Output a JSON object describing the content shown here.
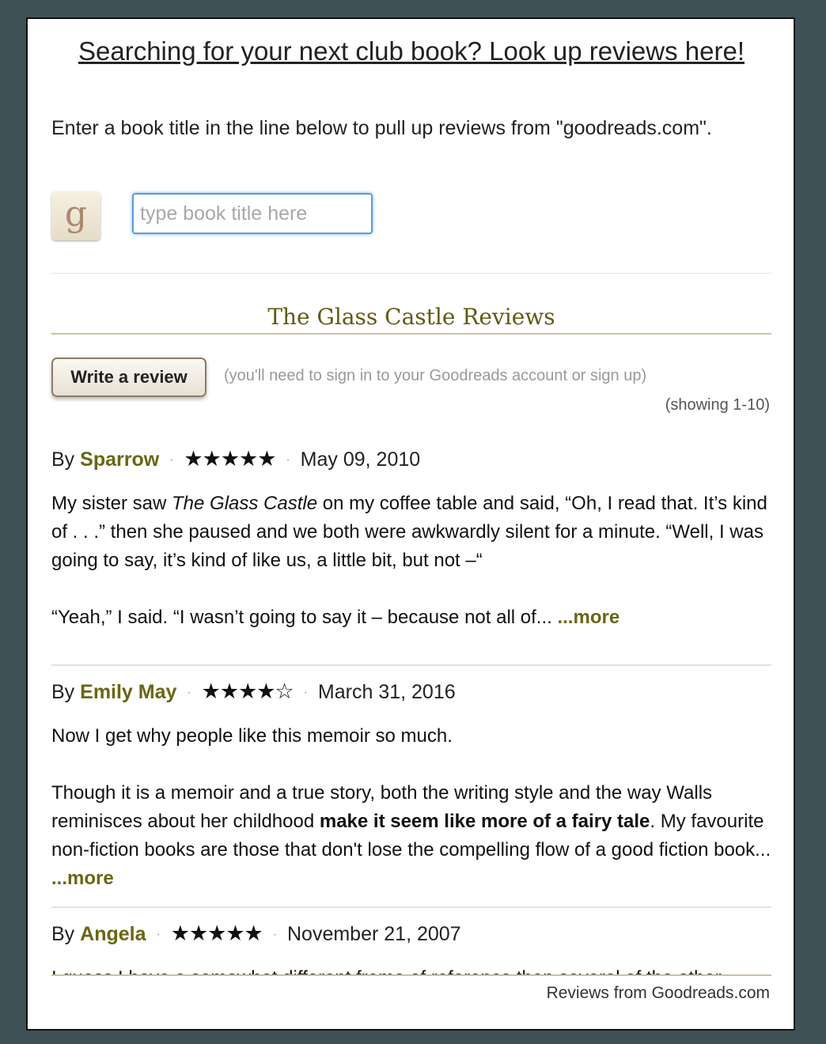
{
  "heading": "Searching for your next club book? Look up reviews here!",
  "intro": "Enter a book title in the line below to pull up reviews from \"goodreads.com\".",
  "logo": {
    "glyph": "g",
    "icon": "goodreads-logo-icon"
  },
  "search": {
    "placeholder": "type book title here",
    "value": ""
  },
  "reviews_title": "The Glass Castle Reviews",
  "write_review_label": "Write a review",
  "signin_note": "(you'll need to sign in to your Goodreads account or sign up)",
  "showing": "(showing 1-10)",
  "separator": "·",
  "more_label": "...more",
  "reviews": [
    {
      "by": "By",
      "author": "Sparrow",
      "stars": "★★★★★",
      "rating": 5,
      "date": "May 09, 2010",
      "p1_a": "My sister saw ",
      "p1_italic": "The Glass Castle",
      "p1_b": " on my coffee table and said, “Oh, I read that. It’s kind of . . .” then she paused and we both were awkwardly silent for a minute. “Well, I was going to say, it’s kind of like us, a little bit, but not –“",
      "p2": "“Yeah,” I said. “I wasn’t going to say it – because not all of... "
    },
    {
      "by": "By",
      "author": "Emily May",
      "stars": "★★★★☆",
      "rating": 4,
      "date": "March 31, 2016",
      "p1": "Now I get why people like this memoir so much.",
      "p2_a": "Though it is a memoir and a true story, both the writing style and the way Walls reminisces about her childhood ",
      "p2_bold": "make it seem like more of a fairy tale",
      "p2_b": ". My favourite non-fiction books are those that don't lose the compelling flow of a good fiction book... "
    },
    {
      "by": "By",
      "author": "Angela",
      "stars": "★★★★★",
      "rating": 5,
      "date": "November 21, 2007",
      "p1": "I guess I have a somewhat different frame of reference than several of the other reviewers here. I grew up in a very different kind of household..."
    }
  ],
  "footer_credit": "Reviews from Goodreads.com",
  "colors": {
    "background": "#3d5157",
    "accent": "#6a6614",
    "title": "#5f5a15",
    "input_focus": "#5b9dd9"
  }
}
